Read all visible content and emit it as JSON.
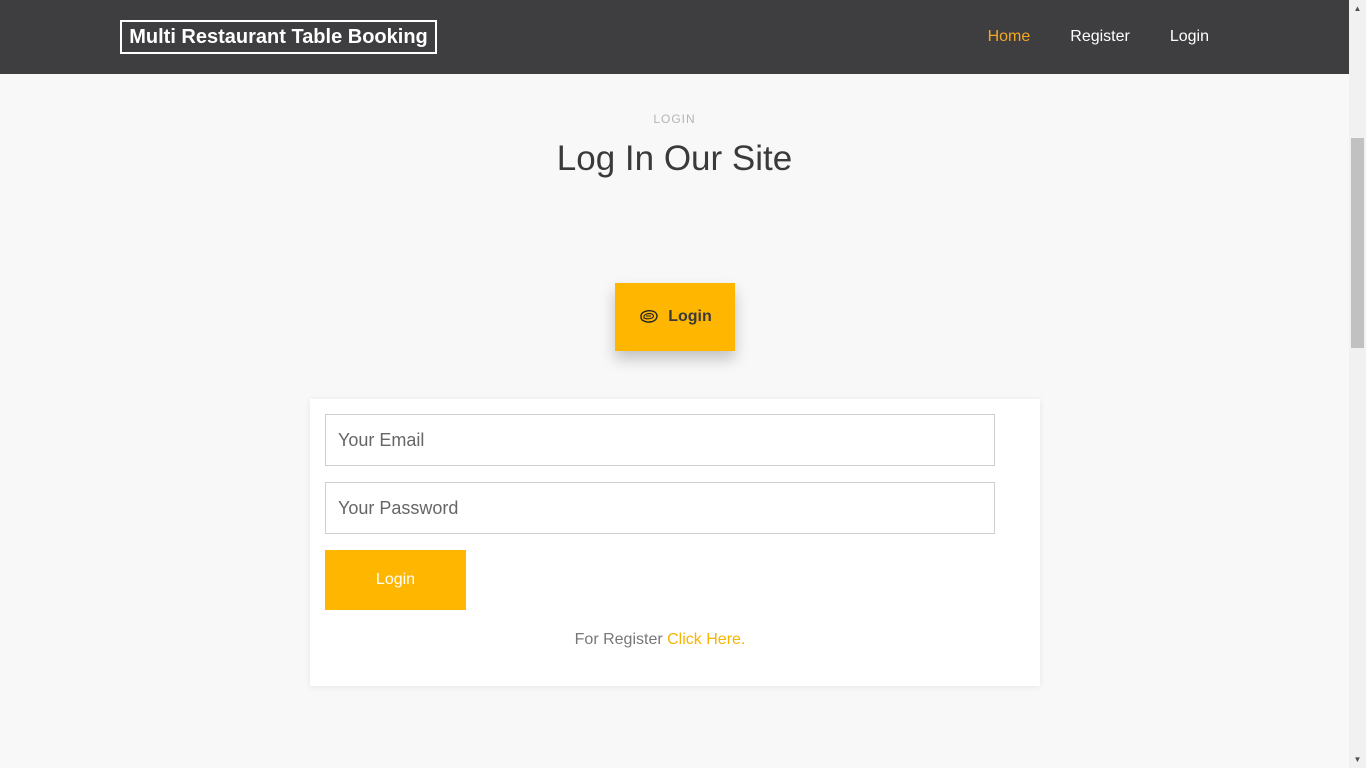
{
  "navbar": {
    "brand": "Multi Restaurant Table Booking",
    "links": [
      {
        "label": "Home",
        "active": true
      },
      {
        "label": "Register",
        "active": false
      },
      {
        "label": "Login",
        "active": false
      }
    ]
  },
  "section": {
    "label": "LOGIN",
    "title": "Log In Our Site"
  },
  "tab": {
    "label": "Login",
    "icon": "meat-steak-icon"
  },
  "form": {
    "email_placeholder": "Your Email",
    "password_placeholder": "Your Password",
    "submit_label": "Login",
    "register_prefix": "For Register",
    "register_link": "Click Here."
  },
  "colors": {
    "navbar_bg": "#3e3e40",
    "accent": "#ffb600",
    "active_link": "#f5a623"
  }
}
